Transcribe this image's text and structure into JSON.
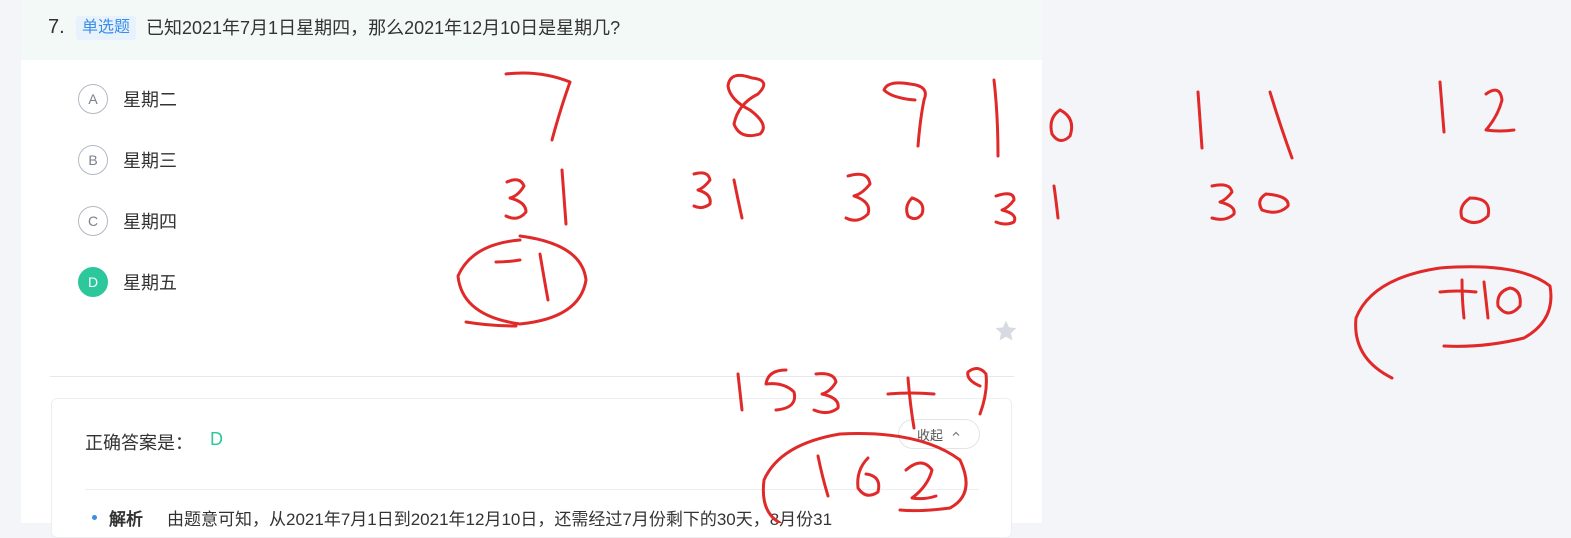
{
  "question": {
    "number": "7.",
    "type_tag": "单选题",
    "text": "已知2021年7月1日星期四，那么2021年12月10日是星期几?"
  },
  "options": [
    {
      "letter": "A",
      "label": "星期二",
      "selected": false
    },
    {
      "letter": "B",
      "label": "星期三",
      "selected": false
    },
    {
      "letter": "C",
      "label": "星期四",
      "selected": false
    },
    {
      "letter": "D",
      "label": "星期五",
      "selected": true
    }
  ],
  "answer": {
    "label": "正确答案是：",
    "value": "D",
    "collapse_label": "收起"
  },
  "analysis": {
    "title": "解析",
    "text": "由题意可知，从2021年7月1日到2021年12月10日，还需经过7月份剩下的30天，8月份31"
  },
  "icons": {
    "favorite": "star-icon",
    "collapse": "chevron-up-icon"
  },
  "colors": {
    "accent_green": "#2cc79a",
    "tag_blue": "#3a8ee6",
    "ink_red": "#e02a2a"
  }
}
